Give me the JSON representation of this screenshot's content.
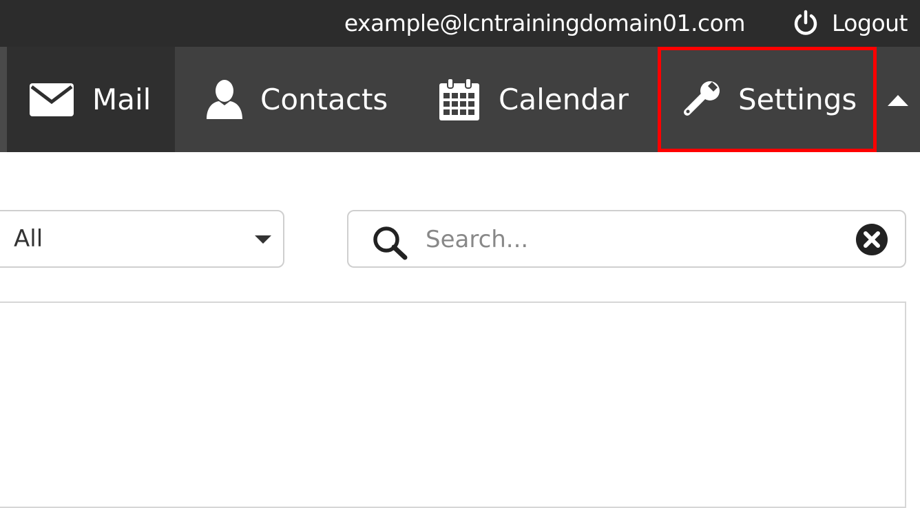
{
  "topbar": {
    "user_email": "example@lcntrainingdomain01.com",
    "logout_label": "Logout",
    "logout_icon": "power-icon"
  },
  "nav": {
    "items": [
      {
        "label": "Mail",
        "icon": "envelope-icon"
      },
      {
        "label": "Contacts",
        "icon": "user-icon"
      },
      {
        "label": "Calendar",
        "icon": "calendar-icon"
      },
      {
        "label": "Settings",
        "icon": "wrench-icon"
      }
    ],
    "collapse_icon": "caret-up-icon"
  },
  "toolbar": {
    "filter_value": "All",
    "search_placeholder": "Search...",
    "search_value": ""
  },
  "colors": {
    "topbar_bg": "#2c2c2c",
    "navbar_bg": "#404040",
    "active_tab_bg": "#2f2f2f",
    "highlight_border": "#ff0000"
  }
}
